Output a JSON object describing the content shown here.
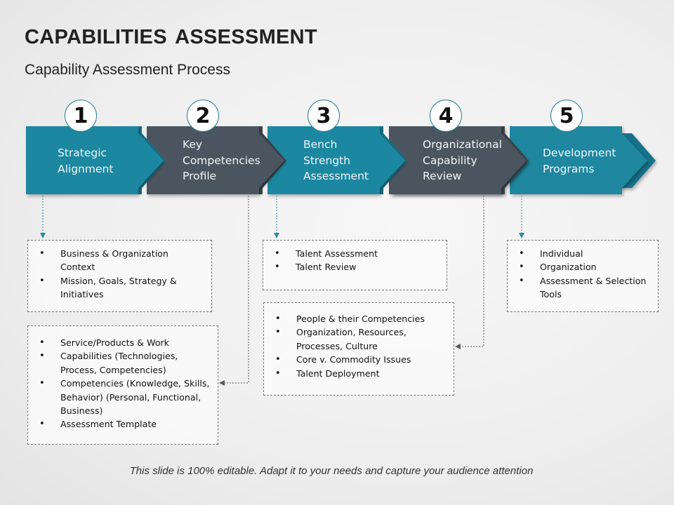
{
  "header": {
    "title": "CAPABILITIES ASSESSMENT",
    "subtitle": "Capability Assessment Process"
  },
  "colors": {
    "teal": "#1f87a0",
    "slate": "#4b5560",
    "connector_teal": "#2b8aa3",
    "connector_gray": "#555b62"
  },
  "steps": [
    {
      "number": "1",
      "label": "Strategic\nAlignment",
      "color": "teal"
    },
    {
      "number": "2",
      "label": "Key\nCompetencies\nProfile",
      "color": "slate"
    },
    {
      "number": "3",
      "label": "Bench\nStrength\nAssessment",
      "color": "teal"
    },
    {
      "number": "4",
      "label": "Organizational\nCapability\nReview",
      "color": "slate"
    },
    {
      "number": "5",
      "label": "Development\nPrograms",
      "color": "teal"
    }
  ],
  "boxes": {
    "strategic_alignment": {
      "items": [
        "Business & Organization Context",
        "Mission, Goals, Strategy & Initiatives"
      ]
    },
    "key_competencies": {
      "items": [
        "Service/Products  & Work",
        "Capabilities (Technologies, Process, Competencies)",
        "Competencies (Knowledge, Skills, Behavior) (Personal, Functional,  Business)",
        "Assessment Template"
      ]
    },
    "bench_strength": {
      "items": [
        "Talent Assessment",
        "Talent Review"
      ]
    },
    "org_capability": {
      "items": [
        "People & their Competencies",
        "Organization, Resources, Processes, Culture",
        "Core v. Commodity  Issues",
        "Talent Deployment"
      ]
    },
    "development_programs": {
      "items": [
        "Individual",
        "Organization",
        "Assessment & Selection Tools"
      ]
    }
  },
  "footer": "This slide is 100% editable. Adapt it to your needs and capture your audience attention"
}
